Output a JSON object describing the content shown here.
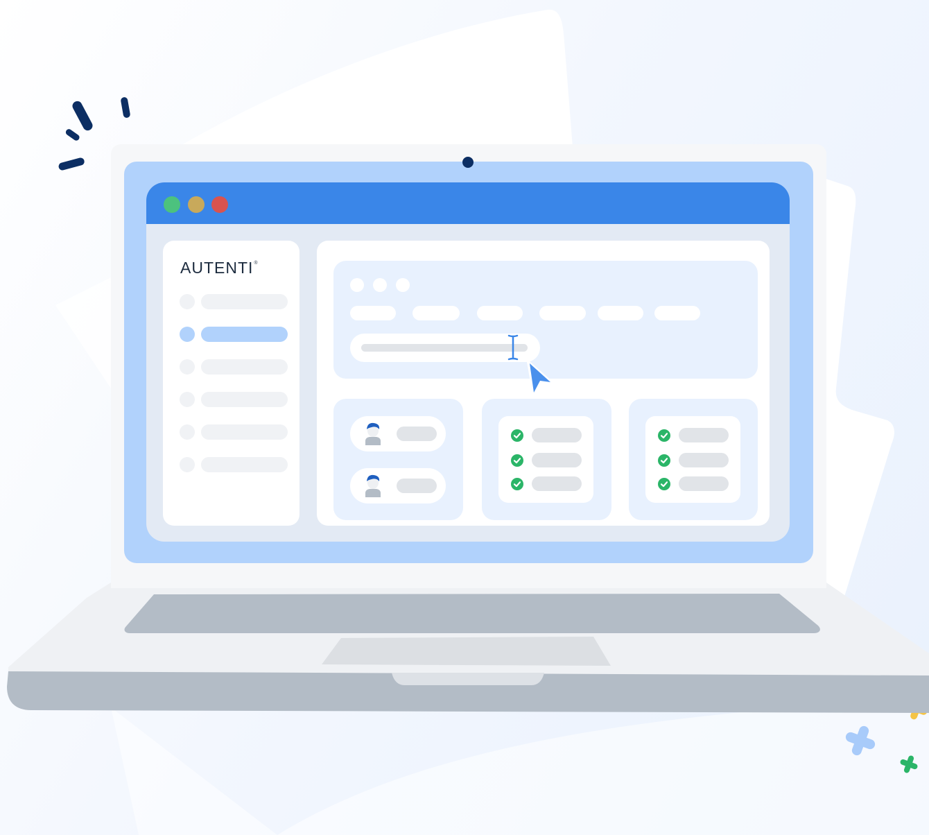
{
  "window": {
    "traffic_lights": [
      "#4cc27e",
      "#c8a95b",
      "#d9534f"
    ],
    "titlebar_color": "#3a86e8"
  },
  "sidebar": {
    "logo_text": "AUTENTI",
    "logo_mark": "®",
    "active_index": 1,
    "items": [
      "nav-1",
      "nav-2",
      "nav-3",
      "nav-4",
      "nav-5",
      "nav-6"
    ]
  },
  "toolbar": {
    "window_dots": 3,
    "tabs": 6
  },
  "cards": {
    "users_count": 2,
    "checklist_a_count": 3,
    "checklist_b_count": 3
  },
  "colors": {
    "accent": "#3a86e8",
    "light_accent": "#b1d2fc",
    "check_green": "#2bb568",
    "navy": "#0c2e63"
  },
  "icons": {
    "cursor": "text-cursor-icon",
    "pointer": "mouse-pointer-icon",
    "check": "check-circle-icon",
    "user": "user-avatar-icon"
  }
}
